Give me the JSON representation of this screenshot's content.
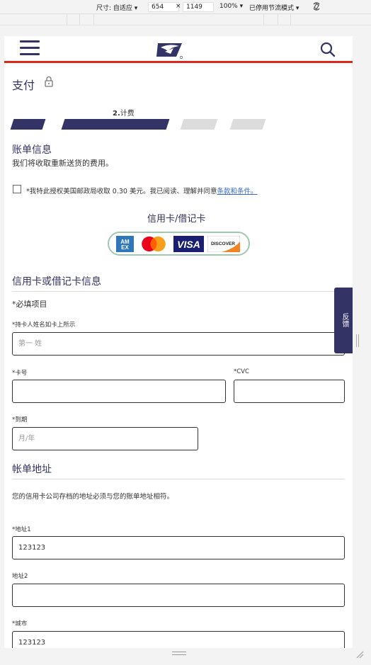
{
  "devtools": {
    "size_label": "尺寸: 自适应",
    "width": "654",
    "times": "×",
    "height": "1149",
    "zoom": "100%",
    "throttle": "已停用节流模式",
    "rotate_icon": "rotate-icon"
  },
  "header": {
    "menu_icon": "hamburger-menu-icon",
    "logo_icon": "usps-eagle-logo",
    "search_icon": "search-icon",
    "accent": "#da291c",
    "brand": "#333366"
  },
  "page": {
    "title": "支付",
    "step_number": "2.",
    "step_name": "计费",
    "progress": {
      "total_steps": 4,
      "current_step": 2
    }
  },
  "billing": {
    "heading": "账单信息",
    "subtext": "我们将收取重新送货的费用。",
    "consent_text": "*我特此授权美国邮政局收取 0.30 美元。我已阅读、理解并同意",
    "consent_link": "条款和条件。",
    "checked": false
  },
  "cards": {
    "heading": "信用卡/借记卡",
    "logos": [
      "AMEX",
      "mastercard",
      "VISA",
      "DISCOVER"
    ]
  },
  "card_info": {
    "heading": "信用卡或借记卡信息",
    "required_note": "*必填项目",
    "name_label": "*持卡人姓名如卡上所示",
    "name_placeholder": "第一 姓",
    "number_label": "*卡号",
    "number_value": "",
    "cvc_label": "*CVC",
    "cvc_value": "",
    "expiry_label": "*到期",
    "expiry_placeholder": "月/年"
  },
  "address": {
    "heading": "帐单地址",
    "note": "您的信用卡公司存档的地址必须与您的账单地址相符。",
    "address1_label": "*地址1",
    "address1_value": "123123",
    "address2_label": "地址2",
    "address2_value": "",
    "city_label": "*城市",
    "city_value": "123123"
  },
  "feedback": {
    "label": "反馈"
  }
}
